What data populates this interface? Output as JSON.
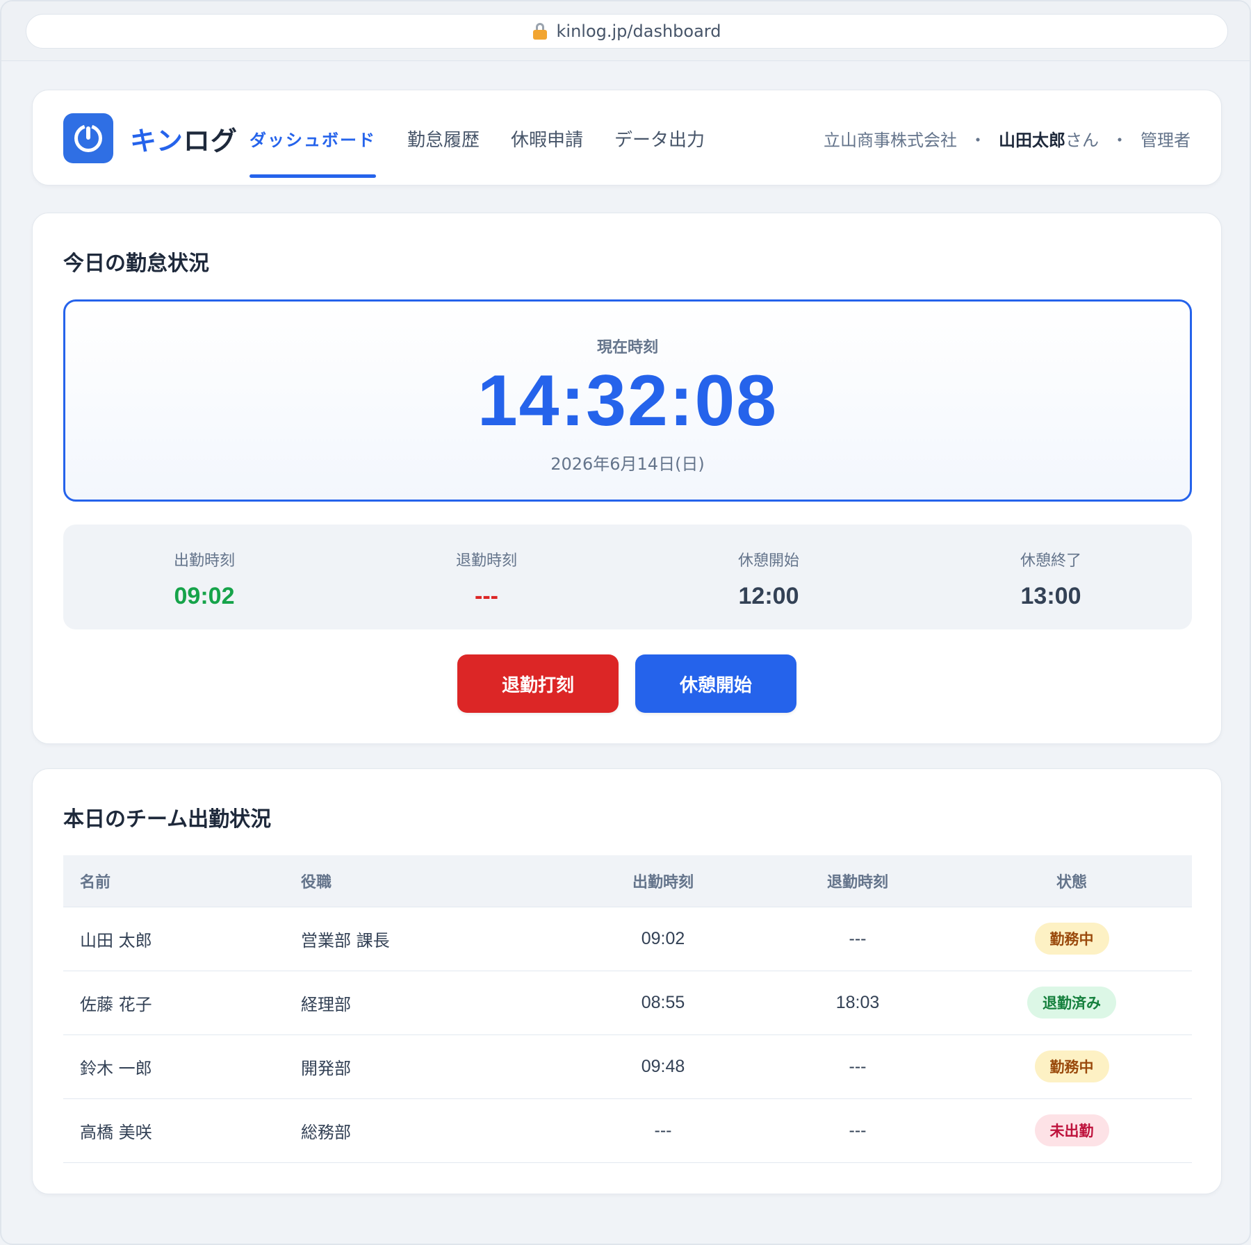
{
  "browser": {
    "url": "kinlog.jp/dashboard"
  },
  "nav": {
    "brand_main": "キン",
    "brand_rest": "ログ",
    "tabs": [
      {
        "label": "ダッシュボード",
        "active": true
      },
      {
        "label": "勤怠履歴",
        "active": false
      },
      {
        "label": "休暇申請",
        "active": false
      },
      {
        "label": "データ出力",
        "active": false
      }
    ],
    "company": "立山商事株式会社",
    "user_name": "山田太郎",
    "user_suffix": "さん",
    "role": "管理者",
    "separator": "・"
  },
  "today": {
    "title": "今日の勤怠状況",
    "clock_label": "現在時刻",
    "clock_time": "14:32:08",
    "clock_date": "2026年6月14日(日)",
    "stats": [
      {
        "label": "出勤時刻",
        "value": "09:02"
      },
      {
        "label": "退勤時刻",
        "value": "---"
      },
      {
        "label": "休憩開始",
        "value": "12:00"
      },
      {
        "label": "休憩終了",
        "value": "13:00"
      }
    ],
    "clock_out_button": "退勤打刻",
    "break_button": "休憩開始"
  },
  "team": {
    "title": "本日のチーム出勤状況",
    "headers": [
      "名前",
      "役職",
      "出勤時刻",
      "退勤時刻",
      "状態"
    ],
    "rows": [
      {
        "name": "山田 太郎",
        "position": "営業部 課長",
        "in": "09:02",
        "out": "---",
        "status": "勤務中"
      },
      {
        "name": "佐藤 花子",
        "position": "経理部",
        "in": "08:55",
        "out": "18:03",
        "status": "退勤済み"
      },
      {
        "name": "鈴木 一郎",
        "position": "開発部",
        "in": "09:48",
        "out": "---",
        "status": "勤務中"
      },
      {
        "name": "高橋 美咲",
        "position": "総務部",
        "in": "---",
        "out": "---",
        "status": "未出勤"
      }
    ]
  },
  "colors": {
    "accent": "#2563eb",
    "danger": "#dc2626",
    "success": "#16a34a",
    "background": "#f0f3f7"
  }
}
